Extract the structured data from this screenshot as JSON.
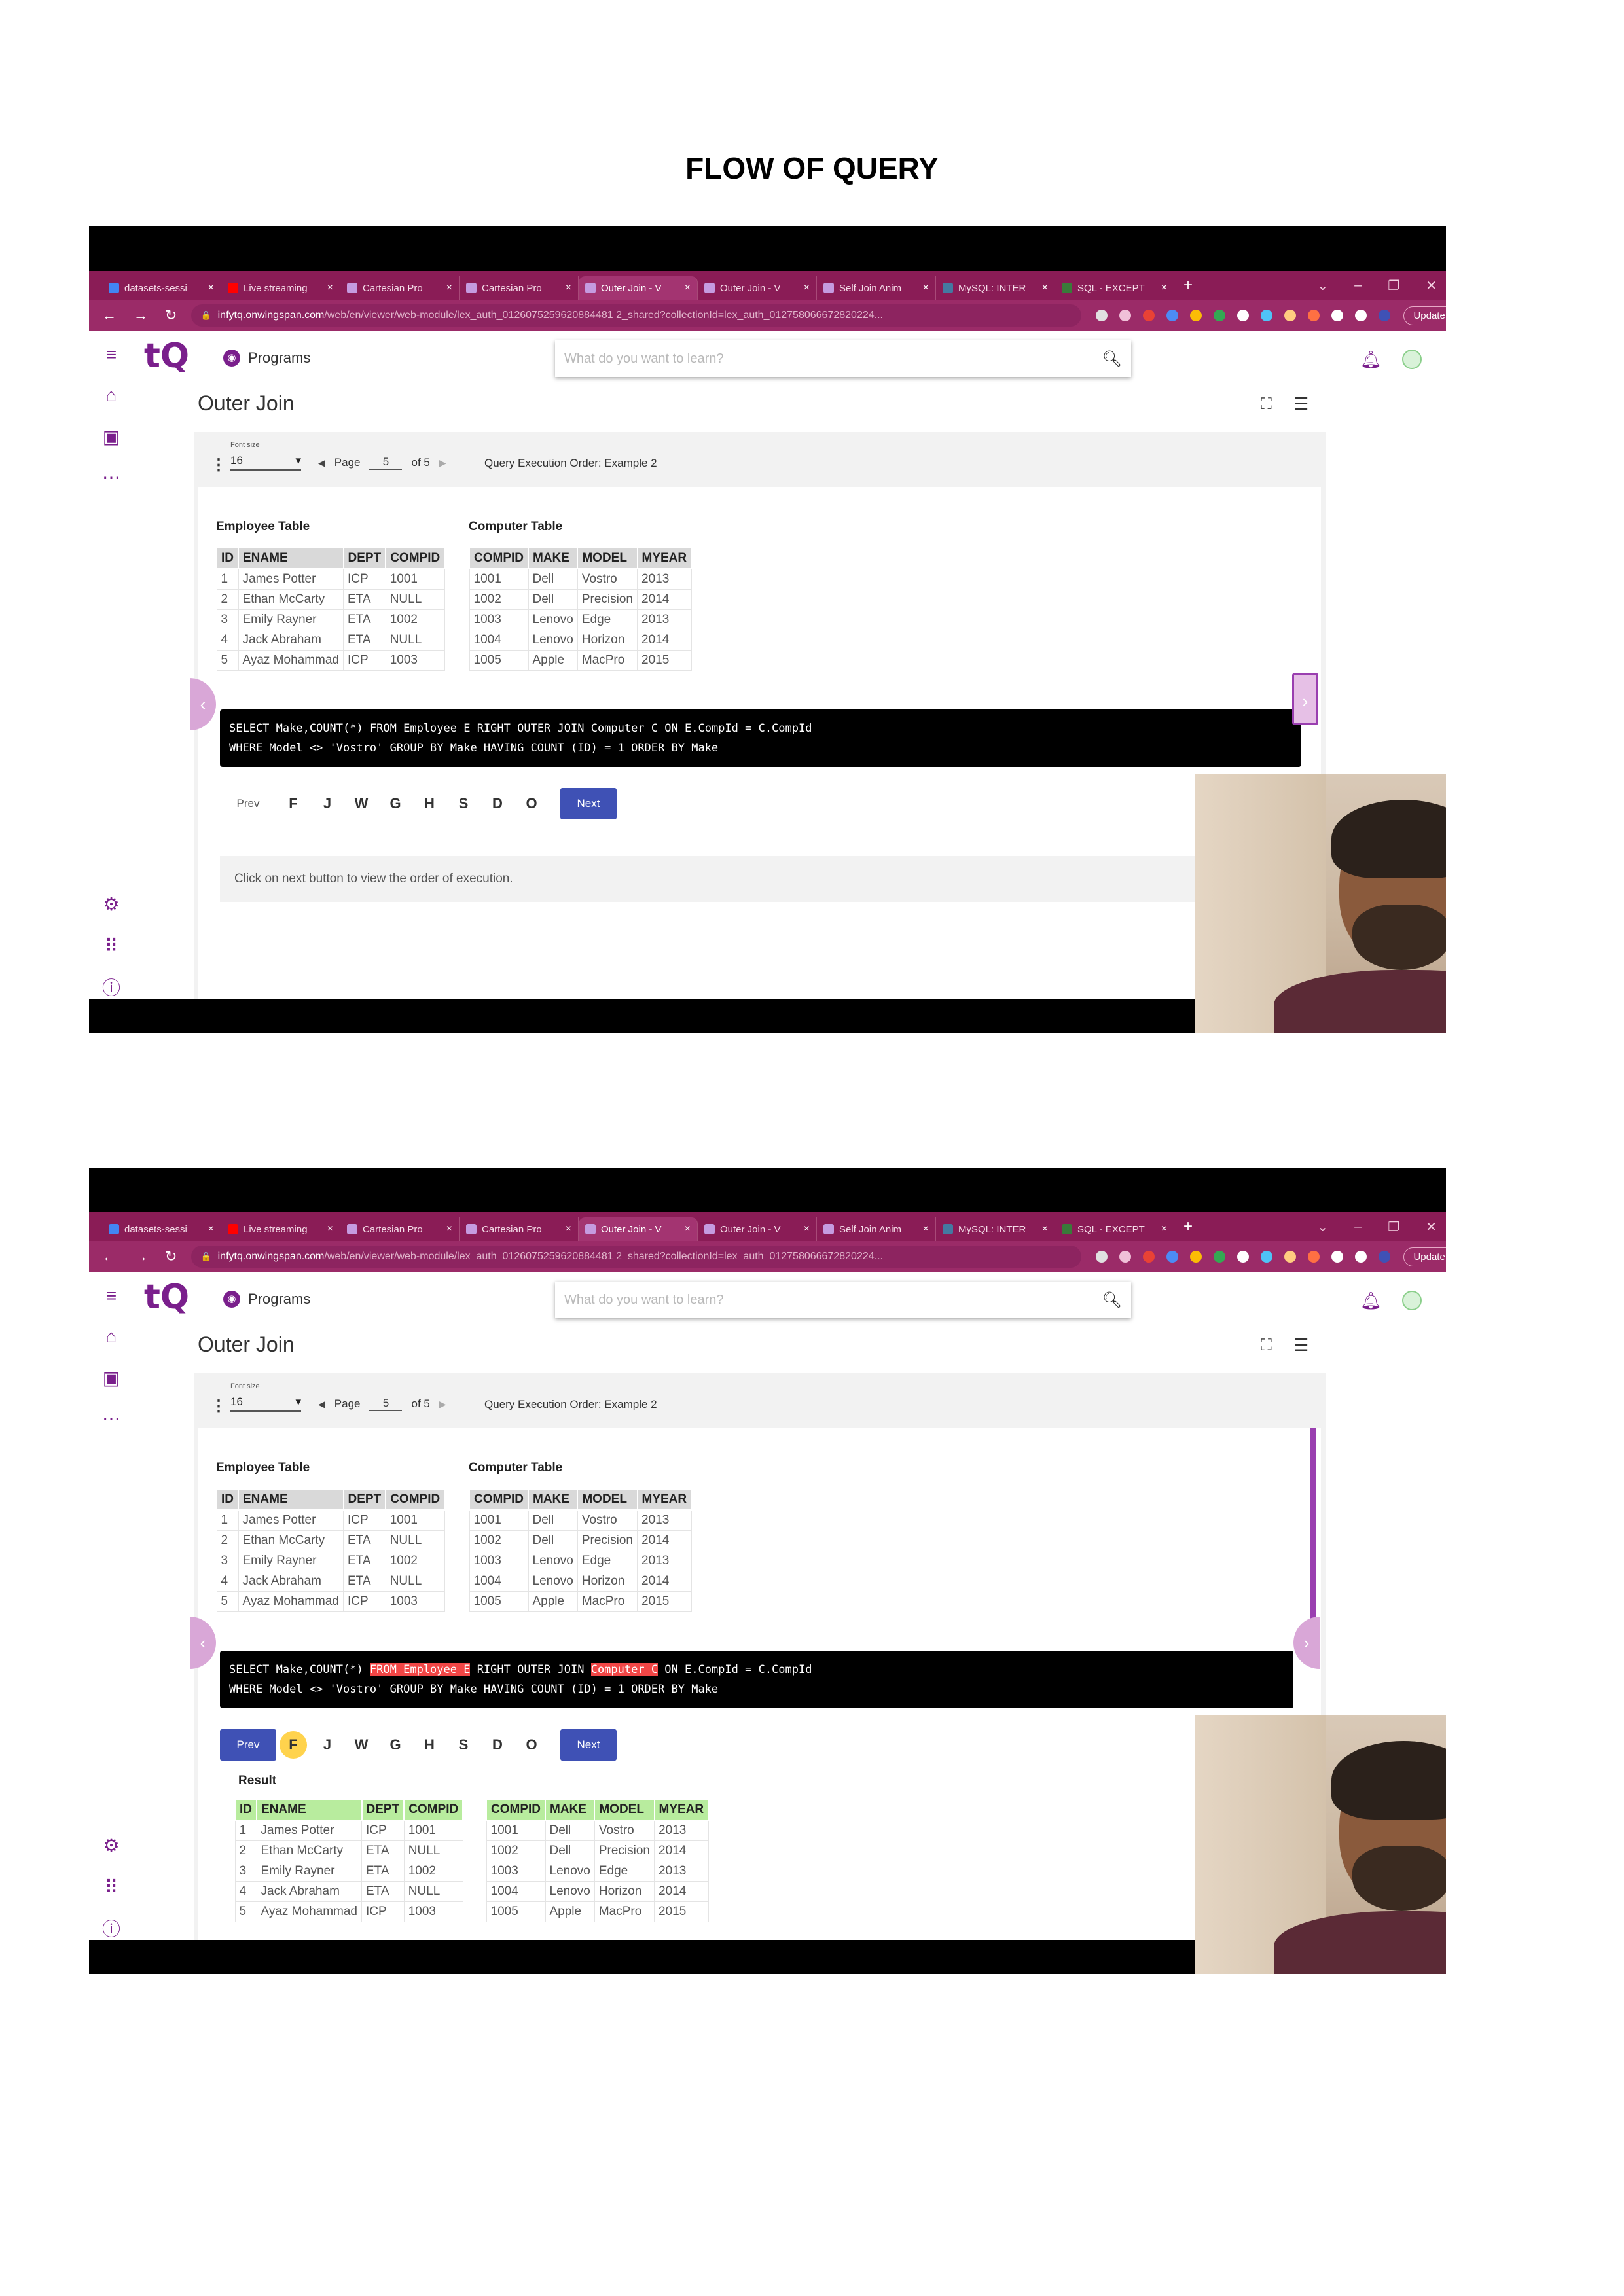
{
  "document": {
    "title": "FLOW OF QUERY"
  },
  "browser": {
    "tabs": [
      {
        "label": "datasets-sessi",
        "favicon_color": "#4285f4"
      },
      {
        "label": "Live streaming",
        "favicon_color": "#ff0000"
      },
      {
        "label": "Cartesian Pro",
        "favicon_color": "#c59be0"
      },
      {
        "label": "Cartesian Pro",
        "favicon_color": "#c59be0"
      },
      {
        "label": "Outer Join - V",
        "favicon_color": "#c59be0"
      },
      {
        "label": "Outer Join - V",
        "favicon_color": "#c59be0"
      },
      {
        "label": "Self Join Anim",
        "favicon_color": "#c59be0"
      },
      {
        "label": "MySQL: INTER",
        "favicon_color": "#4479a1"
      },
      {
        "label": "SQL - EXCEPT",
        "favicon_color": "#3a7a3a"
      }
    ],
    "url_host": "infytq.onwingspan.com",
    "url_path": "/web/en/viewer/web-module/lex_auth_0126075259620884481 2_shared?collectionId=lex_auth_012758066672820224...",
    "update_label": "Update"
  },
  "app": {
    "programs_label": "Programs",
    "search_placeholder": "What do you want to learn?",
    "page_title": "Outer Join",
    "viewer": {
      "font_size_label": "Font size",
      "font_size_value": "16",
      "page_label": "Page",
      "page_value": "5",
      "page_total": "of 5",
      "doc_title": "Query Execution Order: Example 2"
    },
    "employee_title": "Employee Table",
    "computer_title": "Computer Table",
    "employee_headers": [
      "ID",
      "ENAME",
      "DEPT",
      "COMPID"
    ],
    "employee_rows": [
      [
        "1",
        "James Potter",
        "ICP",
        "1001"
      ],
      [
        "2",
        "Ethan McCarty",
        "ETA",
        "NULL"
      ],
      [
        "3",
        "Emily Rayner",
        "ETA",
        "1002"
      ],
      [
        "4",
        "Jack Abraham",
        "ETA",
        "NULL"
      ],
      [
        "5",
        "Ayaz Mohammad",
        "ICP",
        "1003"
      ]
    ],
    "computer_headers": [
      "COMPID",
      "MAKE",
      "MODEL",
      "MYEAR"
    ],
    "computer_rows": [
      [
        "1001",
        "Dell",
        "Vostro",
        "2013"
      ],
      [
        "1002",
        "Dell",
        "Precision",
        "2014"
      ],
      [
        "1003",
        "Lenovo",
        "Edge",
        "2013"
      ],
      [
        "1004",
        "Lenovo",
        "Horizon",
        "2014"
      ],
      [
        "1005",
        "Apple",
        "MacPro",
        "2015"
      ]
    ],
    "sql": {
      "line1_a": "SELECT Make,COUNT(*) ",
      "line1_from": "FROM Employee E",
      "line1_b": " RIGHT OUTER JOIN ",
      "line1_comp": "Computer C",
      "line1_c": " ON E.CompId = C.CompId",
      "line2": "WHERE Model <> 'Vostro' GROUP BY Make HAVING COUNT (ID) = 1 ORDER BY Make"
    },
    "prev_label": "Prev",
    "next_label": "Next",
    "steps": [
      "F",
      "J",
      "W",
      "G",
      "H",
      "S",
      "D",
      "O"
    ],
    "info_text": "Click on next button to view the order of execution.",
    "result_title": "Result"
  },
  "colors": {
    "chrome_tabbar": "#8a1c56",
    "accent_purple": "#7a1f8c",
    "button_blue": "#3f51b5",
    "step_highlight": "#ffd34d",
    "sql_highlight": "#f24646",
    "result_header": "#b8ec9e"
  }
}
